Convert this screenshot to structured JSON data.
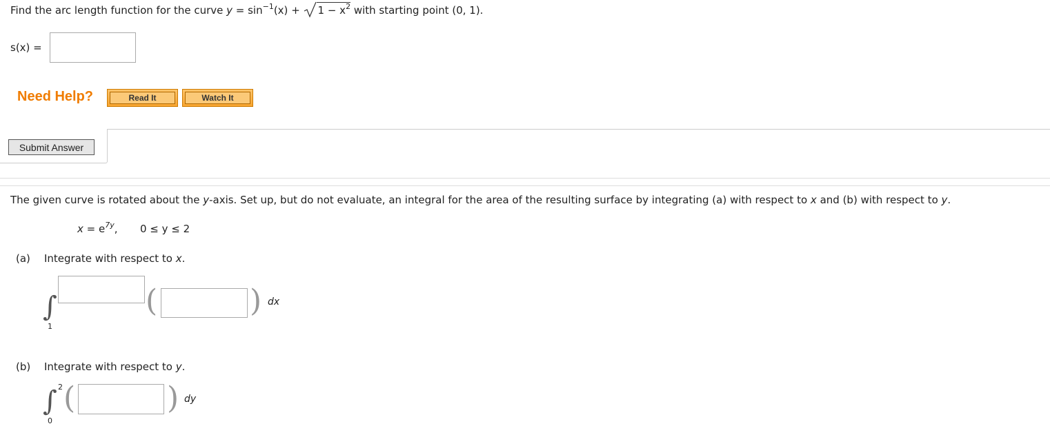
{
  "q1": {
    "prompt_before": "Find the arc length function for the curve ",
    "y_var": "y",
    "eq_sign": " = sin",
    "inverse_exp": "−1",
    "x_arg": "(x)",
    "plus": " + ",
    "root_content": "1 − x",
    "root_exp": "2",
    "prompt_after": " with starting point (0, 1).",
    "answer_label": "s(x) =",
    "answer_value": "",
    "help_label": "Need Help?",
    "read_it": "Read It",
    "watch_it": "Watch It",
    "submit_label": "Submit Answer"
  },
  "q2": {
    "prompt_before": "The given curve is rotated about the ",
    "axis": "y",
    "prompt_mid": "-axis. Set up, but do not evaluate, an integral for the area of the resulting surface by integrating (a) with respect to ",
    "var_x": "x",
    "prompt_mid2": " and (b) with respect to ",
    "var_y": "y",
    "prompt_end": ".",
    "curve_x": "x",
    "curve_eq": " = e",
    "curve_exp": "7y",
    "curve_range": "0 ≤ y ≤ 2",
    "part_a_label": "(a)",
    "part_a_text": "Integrate with respect to ",
    "part_a_var": "x",
    "part_a_lower": "1",
    "part_a_dvar": "dx",
    "part_a_upper_value": "",
    "part_a_integrand_value": "",
    "part_b_label": "(b)",
    "part_b_text": "Integrate with respect to ",
    "part_b_var": "y",
    "part_b_upper": "2",
    "part_b_lower": "0",
    "part_b_dvar": "dy",
    "part_b_integrand_value": ""
  },
  "colors": {
    "help_orange": "#f07c00",
    "button_orange": "#f7a530",
    "border_gray": "#cccccc"
  }
}
